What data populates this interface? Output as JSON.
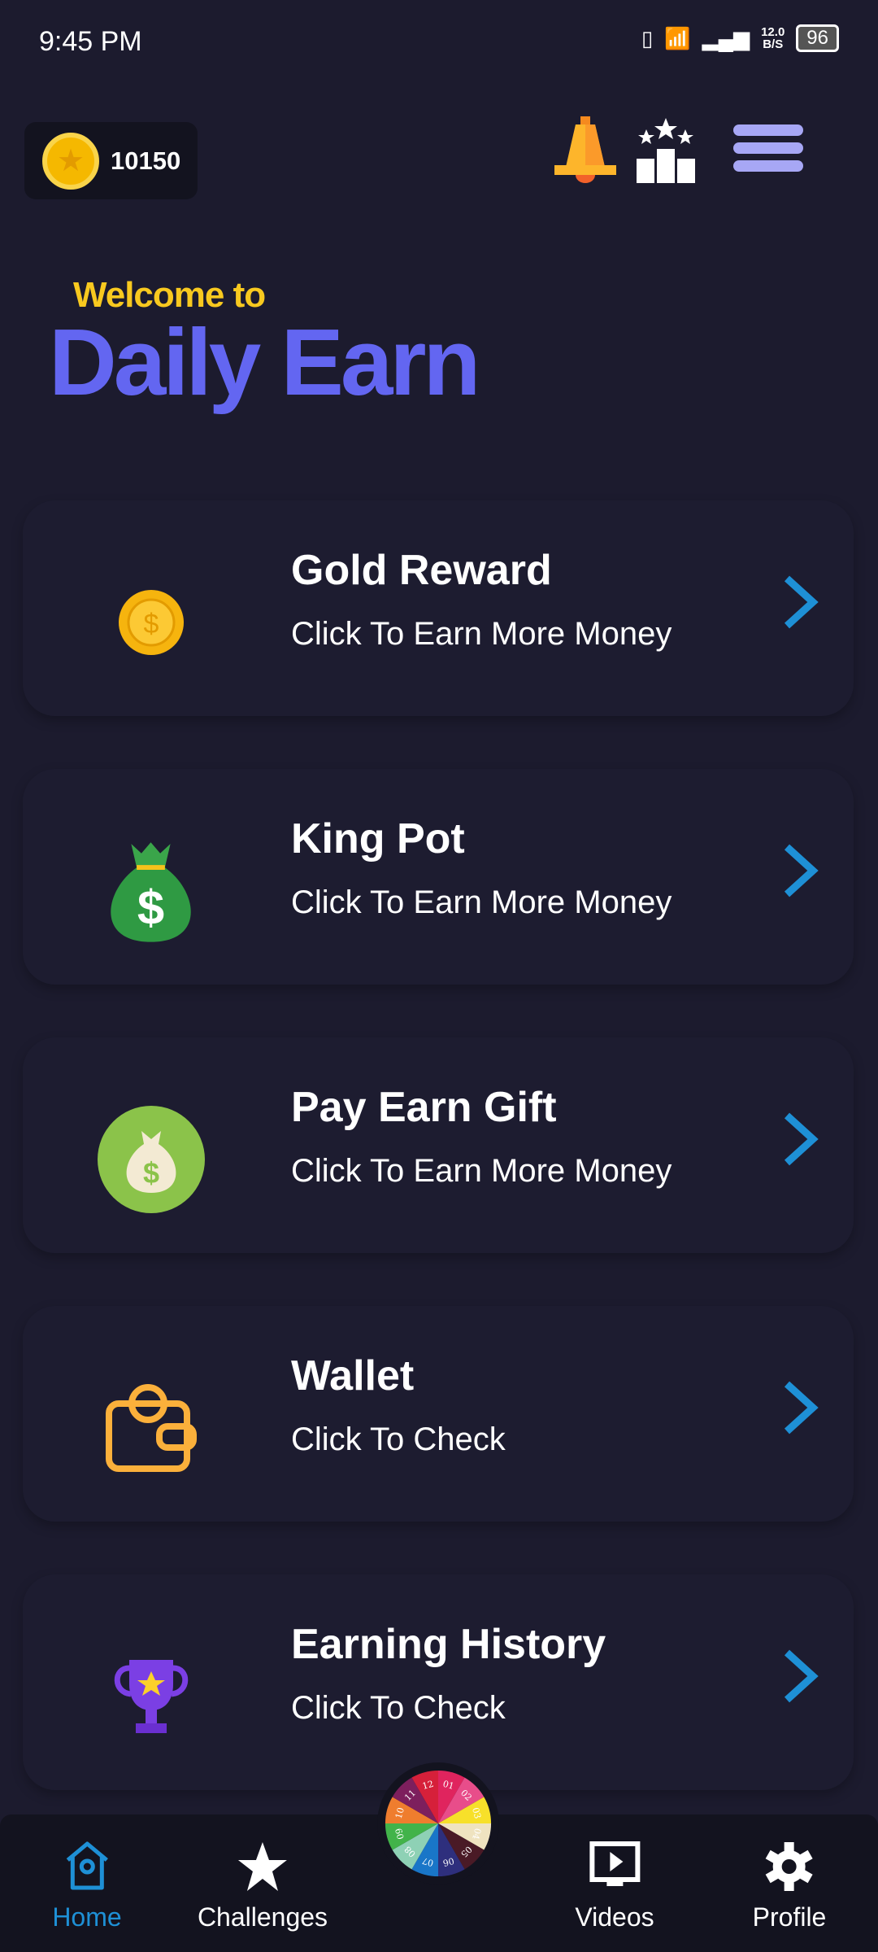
{
  "status_bar": {
    "time": "9:45 PM",
    "net_speed_value": "12.0",
    "net_speed_unit": "B/S",
    "battery": "96"
  },
  "header": {
    "coins": "10150",
    "icons": [
      "coin-icon",
      "bell-icon",
      "leaderboard-icon",
      "menu-icon"
    ]
  },
  "hero": {
    "welcome": "Welcome to",
    "title": "Daily Earn"
  },
  "cards": [
    {
      "title": "Gold Reward",
      "subtitle": "Click To Earn More Money",
      "icon": "gold-coin-icon"
    },
    {
      "title": "King Pot",
      "subtitle": "Click To Earn More Money",
      "icon": "money-bag-icon"
    },
    {
      "title": "Pay Earn Gift",
      "subtitle": "Click To Earn More Money",
      "icon": "gift-bag-icon"
    },
    {
      "title": "Wallet",
      "subtitle": "Click To Check",
      "icon": "wallet-icon"
    },
    {
      "title": "Earning History",
      "subtitle": "Click To Check",
      "icon": "trophy-icon"
    }
  ],
  "nav": {
    "items": [
      {
        "label": "Home",
        "active": true
      },
      {
        "label": "Challenges"
      },
      {
        "label": "Videos"
      },
      {
        "label": "Profile"
      }
    ],
    "wheel_numbers": [
      "01",
      "02",
      "03",
      "04",
      "05",
      "06",
      "07",
      "08",
      "09",
      "10",
      "11",
      "12"
    ],
    "wheel_colors": [
      "#e0245e",
      "#e84d8a",
      "#f7e02a",
      "#efe3c0",
      "#4a1a26",
      "#2e2f7d",
      "#1976c8",
      "#8ed1b5",
      "#42b34a",
      "#ef7d2e",
      "#7d1f5d",
      "#d6203a"
    ],
    "active_color": "#1e90d6"
  },
  "colors": {
    "background": "#1c1b2e",
    "accent": "#6366f1",
    "welcome": "#f8c91f",
    "chevron": "#1e90d6"
  }
}
